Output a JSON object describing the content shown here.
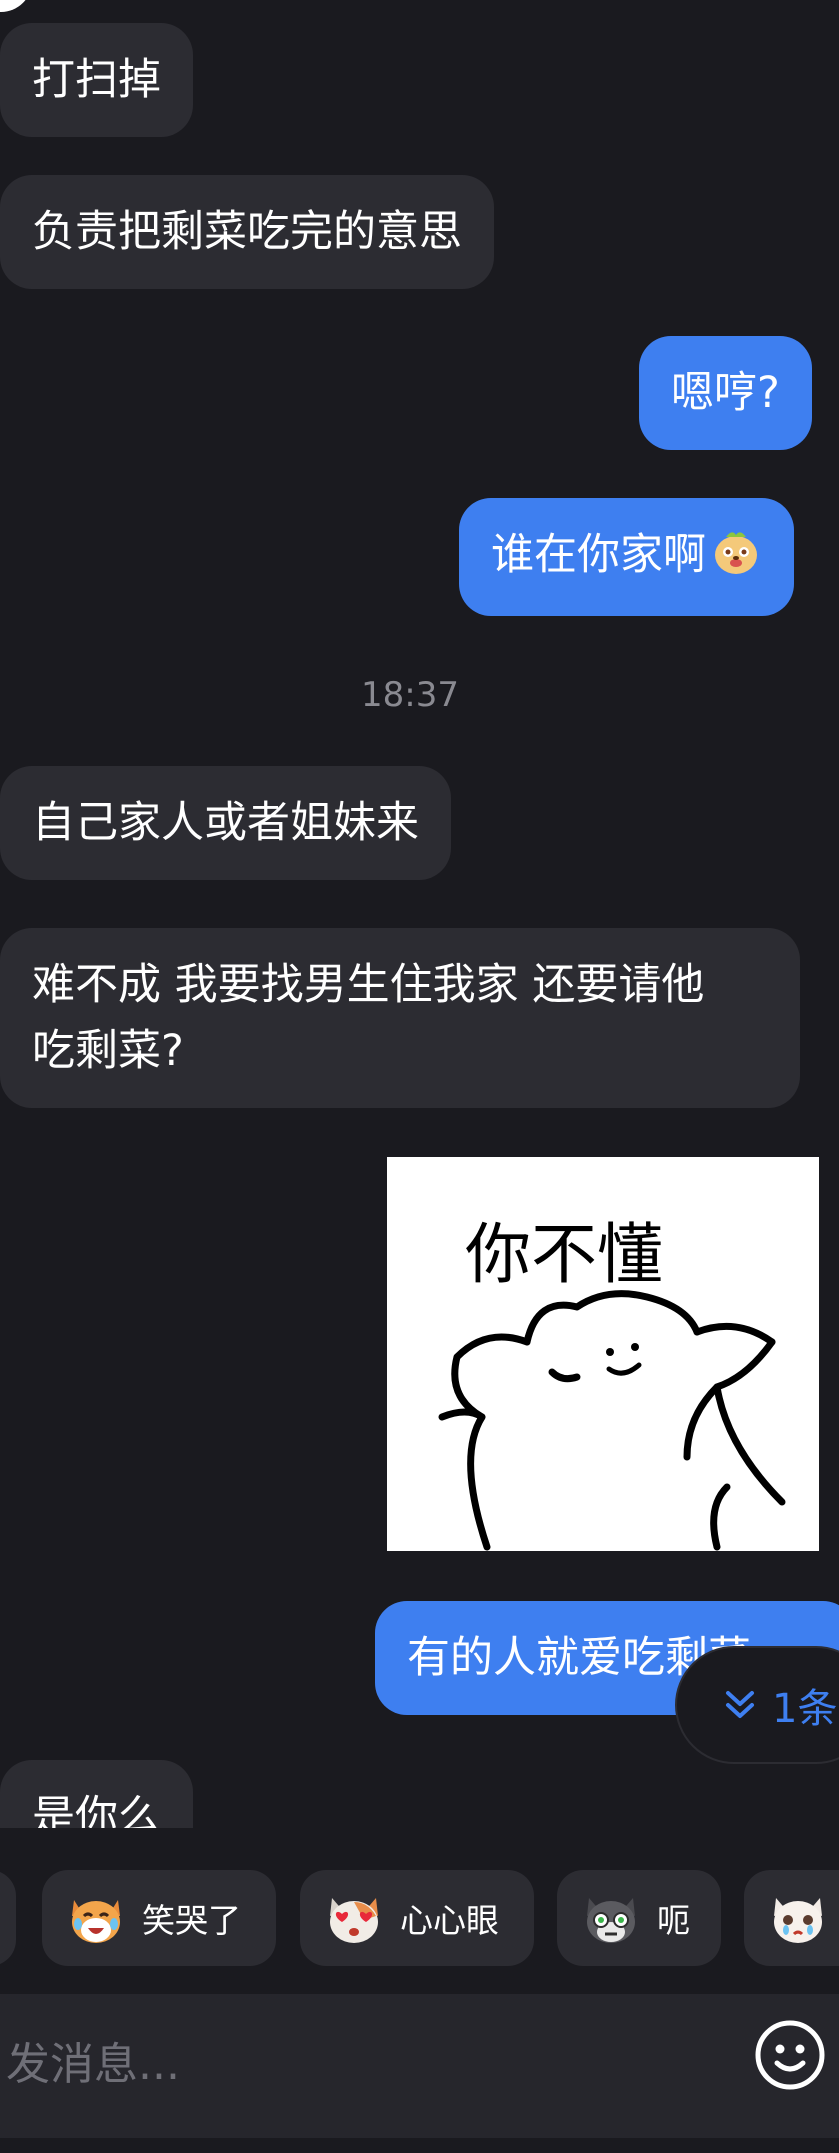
{
  "messages": {
    "m1": "打扫掉",
    "m2": "负责把剩菜吃完的意思",
    "m3": "嗯哼?",
    "m4": "谁在你家啊",
    "timestamp": "18:37",
    "m5": "自己家人或者姐妹来",
    "m6_line1": "难不成 我要找男生住我家 还要请他",
    "m6_line2": "吃剩菜?",
    "sticker_text": "你不懂",
    "m7": "有的人就爱吃剩菜",
    "m8": "是你么"
  },
  "jump_indicator": {
    "label": "1条"
  },
  "quick_replies": [
    {
      "label": "",
      "icon": "partial-chip"
    },
    {
      "label": "笑哭了",
      "icon": "laughing-crying-dog-icon"
    },
    {
      "label": "心心眼",
      "icon": "heart-eyes-cat-icon"
    },
    {
      "label": "呃",
      "icon": "stunned-cat-icon"
    },
    {
      "label": "",
      "icon": "crying-cat-icon"
    }
  ],
  "input": {
    "placeholder": "发消息..."
  },
  "colors": {
    "background": "#1a1a1f",
    "incoming_bubble": "#2c2c32",
    "outgoing_bubble": "#3e7ff0",
    "timestamp": "#8a8a91",
    "input_bar": "#26262c"
  }
}
